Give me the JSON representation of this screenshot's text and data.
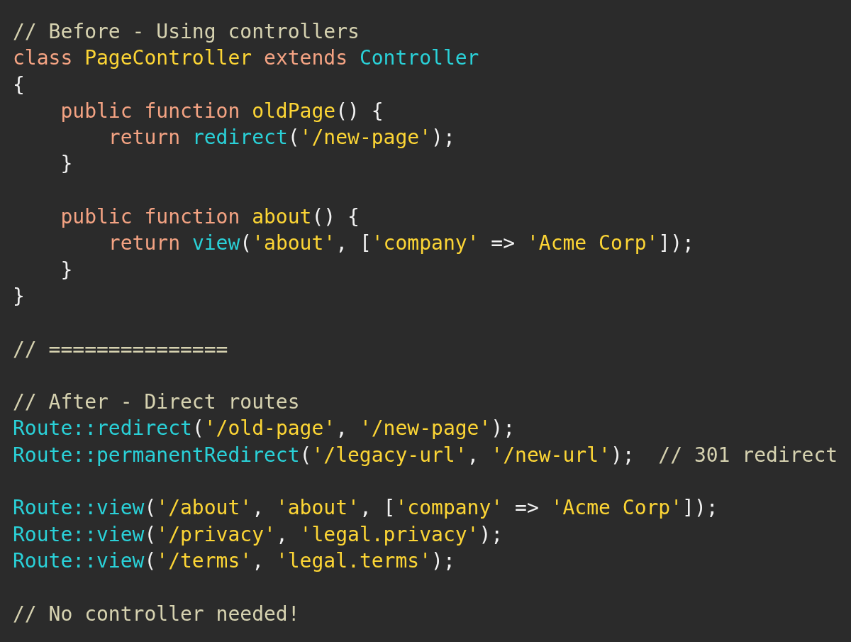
{
  "editor": {
    "lines": [
      {
        "kind": "code",
        "tokens": [
          {
            "kind": "comment",
            "text": "// Before - Using controllers"
          }
        ]
      },
      {
        "kind": "code",
        "tokens": [
          {
            "kind": "keyword",
            "text": "class "
          },
          {
            "kind": "name",
            "text": "PageController "
          },
          {
            "kind": "keyword",
            "text": "extends "
          },
          {
            "kind": "builtin",
            "text": "Controller"
          }
        ]
      },
      {
        "kind": "code",
        "tokens": [
          {
            "kind": "plain",
            "text": "{"
          }
        ]
      },
      {
        "kind": "code",
        "tokens": [
          {
            "kind": "keyword",
            "text": "    public function "
          },
          {
            "kind": "name",
            "text": "oldPage"
          },
          {
            "kind": "plain",
            "text": "() {"
          }
        ]
      },
      {
        "kind": "code",
        "tokens": [
          {
            "kind": "keyword",
            "text": "        return "
          },
          {
            "kind": "builtin",
            "text": "redirect"
          },
          {
            "kind": "plain",
            "text": "("
          },
          {
            "kind": "string",
            "text": "'/new-page'"
          },
          {
            "kind": "plain",
            "text": ");"
          }
        ]
      },
      {
        "kind": "code",
        "tokens": [
          {
            "kind": "plain",
            "text": "    }"
          }
        ]
      },
      {
        "kind": "blank"
      },
      {
        "kind": "code",
        "tokens": [
          {
            "kind": "keyword",
            "text": "    public function "
          },
          {
            "kind": "name",
            "text": "about"
          },
          {
            "kind": "plain",
            "text": "() {"
          }
        ]
      },
      {
        "kind": "code",
        "tokens": [
          {
            "kind": "keyword",
            "text": "        return "
          },
          {
            "kind": "builtin",
            "text": "view"
          },
          {
            "kind": "plain",
            "text": "("
          },
          {
            "kind": "string",
            "text": "'about'"
          },
          {
            "kind": "plain",
            "text": ", ["
          },
          {
            "kind": "string",
            "text": "'company'"
          },
          {
            "kind": "plain",
            "text": " => "
          },
          {
            "kind": "string",
            "text": "'Acme Corp'"
          },
          {
            "kind": "plain",
            "text": "]);"
          }
        ]
      },
      {
        "kind": "code",
        "tokens": [
          {
            "kind": "plain",
            "text": "    }"
          }
        ]
      },
      {
        "kind": "code",
        "tokens": [
          {
            "kind": "plain",
            "text": "}"
          }
        ]
      },
      {
        "kind": "blank"
      },
      {
        "kind": "code",
        "tokens": [
          {
            "kind": "comment",
            "text": "// ==============="
          }
        ]
      },
      {
        "kind": "blank"
      },
      {
        "kind": "code",
        "tokens": [
          {
            "kind": "comment",
            "text": "// After - Direct routes"
          }
        ]
      },
      {
        "kind": "code",
        "tokens": [
          {
            "kind": "builtin",
            "text": "Route::redirect"
          },
          {
            "kind": "plain",
            "text": "("
          },
          {
            "kind": "string",
            "text": "'/old-page'"
          },
          {
            "kind": "plain",
            "text": ", "
          },
          {
            "kind": "string",
            "text": "'/new-page'"
          },
          {
            "kind": "plain",
            "text": ");"
          }
        ]
      },
      {
        "kind": "code",
        "tokens": [
          {
            "kind": "builtin",
            "text": "Route::permanentRedirect"
          },
          {
            "kind": "plain",
            "text": "("
          },
          {
            "kind": "string",
            "text": "'/legacy-url'"
          },
          {
            "kind": "plain",
            "text": ", "
          },
          {
            "kind": "string",
            "text": "'/new-url'"
          },
          {
            "kind": "plain",
            "text": ");  "
          },
          {
            "kind": "comment",
            "text": "// 301 redirect"
          }
        ]
      },
      {
        "kind": "blank"
      },
      {
        "kind": "code",
        "tokens": [
          {
            "kind": "builtin",
            "text": "Route::view"
          },
          {
            "kind": "plain",
            "text": "("
          },
          {
            "kind": "string",
            "text": "'/about'"
          },
          {
            "kind": "plain",
            "text": ", "
          },
          {
            "kind": "string",
            "text": "'about'"
          },
          {
            "kind": "plain",
            "text": ", ["
          },
          {
            "kind": "string",
            "text": "'company'"
          },
          {
            "kind": "plain",
            "text": " => "
          },
          {
            "kind": "string",
            "text": "'Acme Corp'"
          },
          {
            "kind": "plain",
            "text": "]);"
          }
        ]
      },
      {
        "kind": "code",
        "tokens": [
          {
            "kind": "builtin",
            "text": "Route::view"
          },
          {
            "kind": "plain",
            "text": "("
          },
          {
            "kind": "string",
            "text": "'/privacy'"
          },
          {
            "kind": "plain",
            "text": ", "
          },
          {
            "kind": "string",
            "text": "'legal.privacy'"
          },
          {
            "kind": "plain",
            "text": ");"
          }
        ]
      },
      {
        "kind": "code",
        "tokens": [
          {
            "kind": "builtin",
            "text": "Route::view"
          },
          {
            "kind": "plain",
            "text": "("
          },
          {
            "kind": "string",
            "text": "'/terms'"
          },
          {
            "kind": "plain",
            "text": ", "
          },
          {
            "kind": "string",
            "text": "'legal.terms'"
          },
          {
            "kind": "plain",
            "text": ");"
          }
        ]
      },
      {
        "kind": "blank"
      },
      {
        "kind": "code",
        "tokens": [
          {
            "kind": "comment",
            "text": "// No controller needed!"
          }
        ]
      }
    ]
  }
}
